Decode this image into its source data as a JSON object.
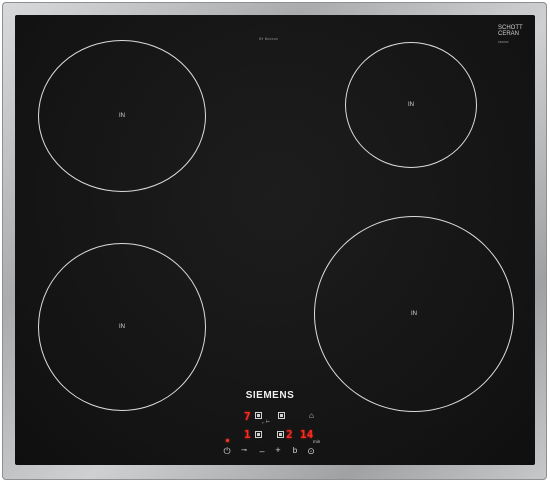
{
  "top_label": "IH 6xxxxx",
  "schott": {
    "line1": "SCHOTT",
    "line2": "CERAN",
    "sub": "xxxxxx"
  },
  "zones": [
    {
      "label": "IN"
    },
    {
      "label": "IN"
    },
    {
      "label": "IN"
    },
    {
      "label": "IN"
    }
  ],
  "brand": "SIEMENS",
  "displays": {
    "zone_top_left_level": "7",
    "zone_bottom_left_level": "1",
    "timer_minutes": "2",
    "timer_seconds": "14",
    "timer_unit": "min"
  },
  "controls": {
    "power": "⏻",
    "minus": "–",
    "plus": "+",
    "boost": "b",
    "lock": "⊙"
  },
  "colors": {
    "glass": "#141414",
    "frame": "#b8babc",
    "display_red": "#ff2a1f"
  }
}
